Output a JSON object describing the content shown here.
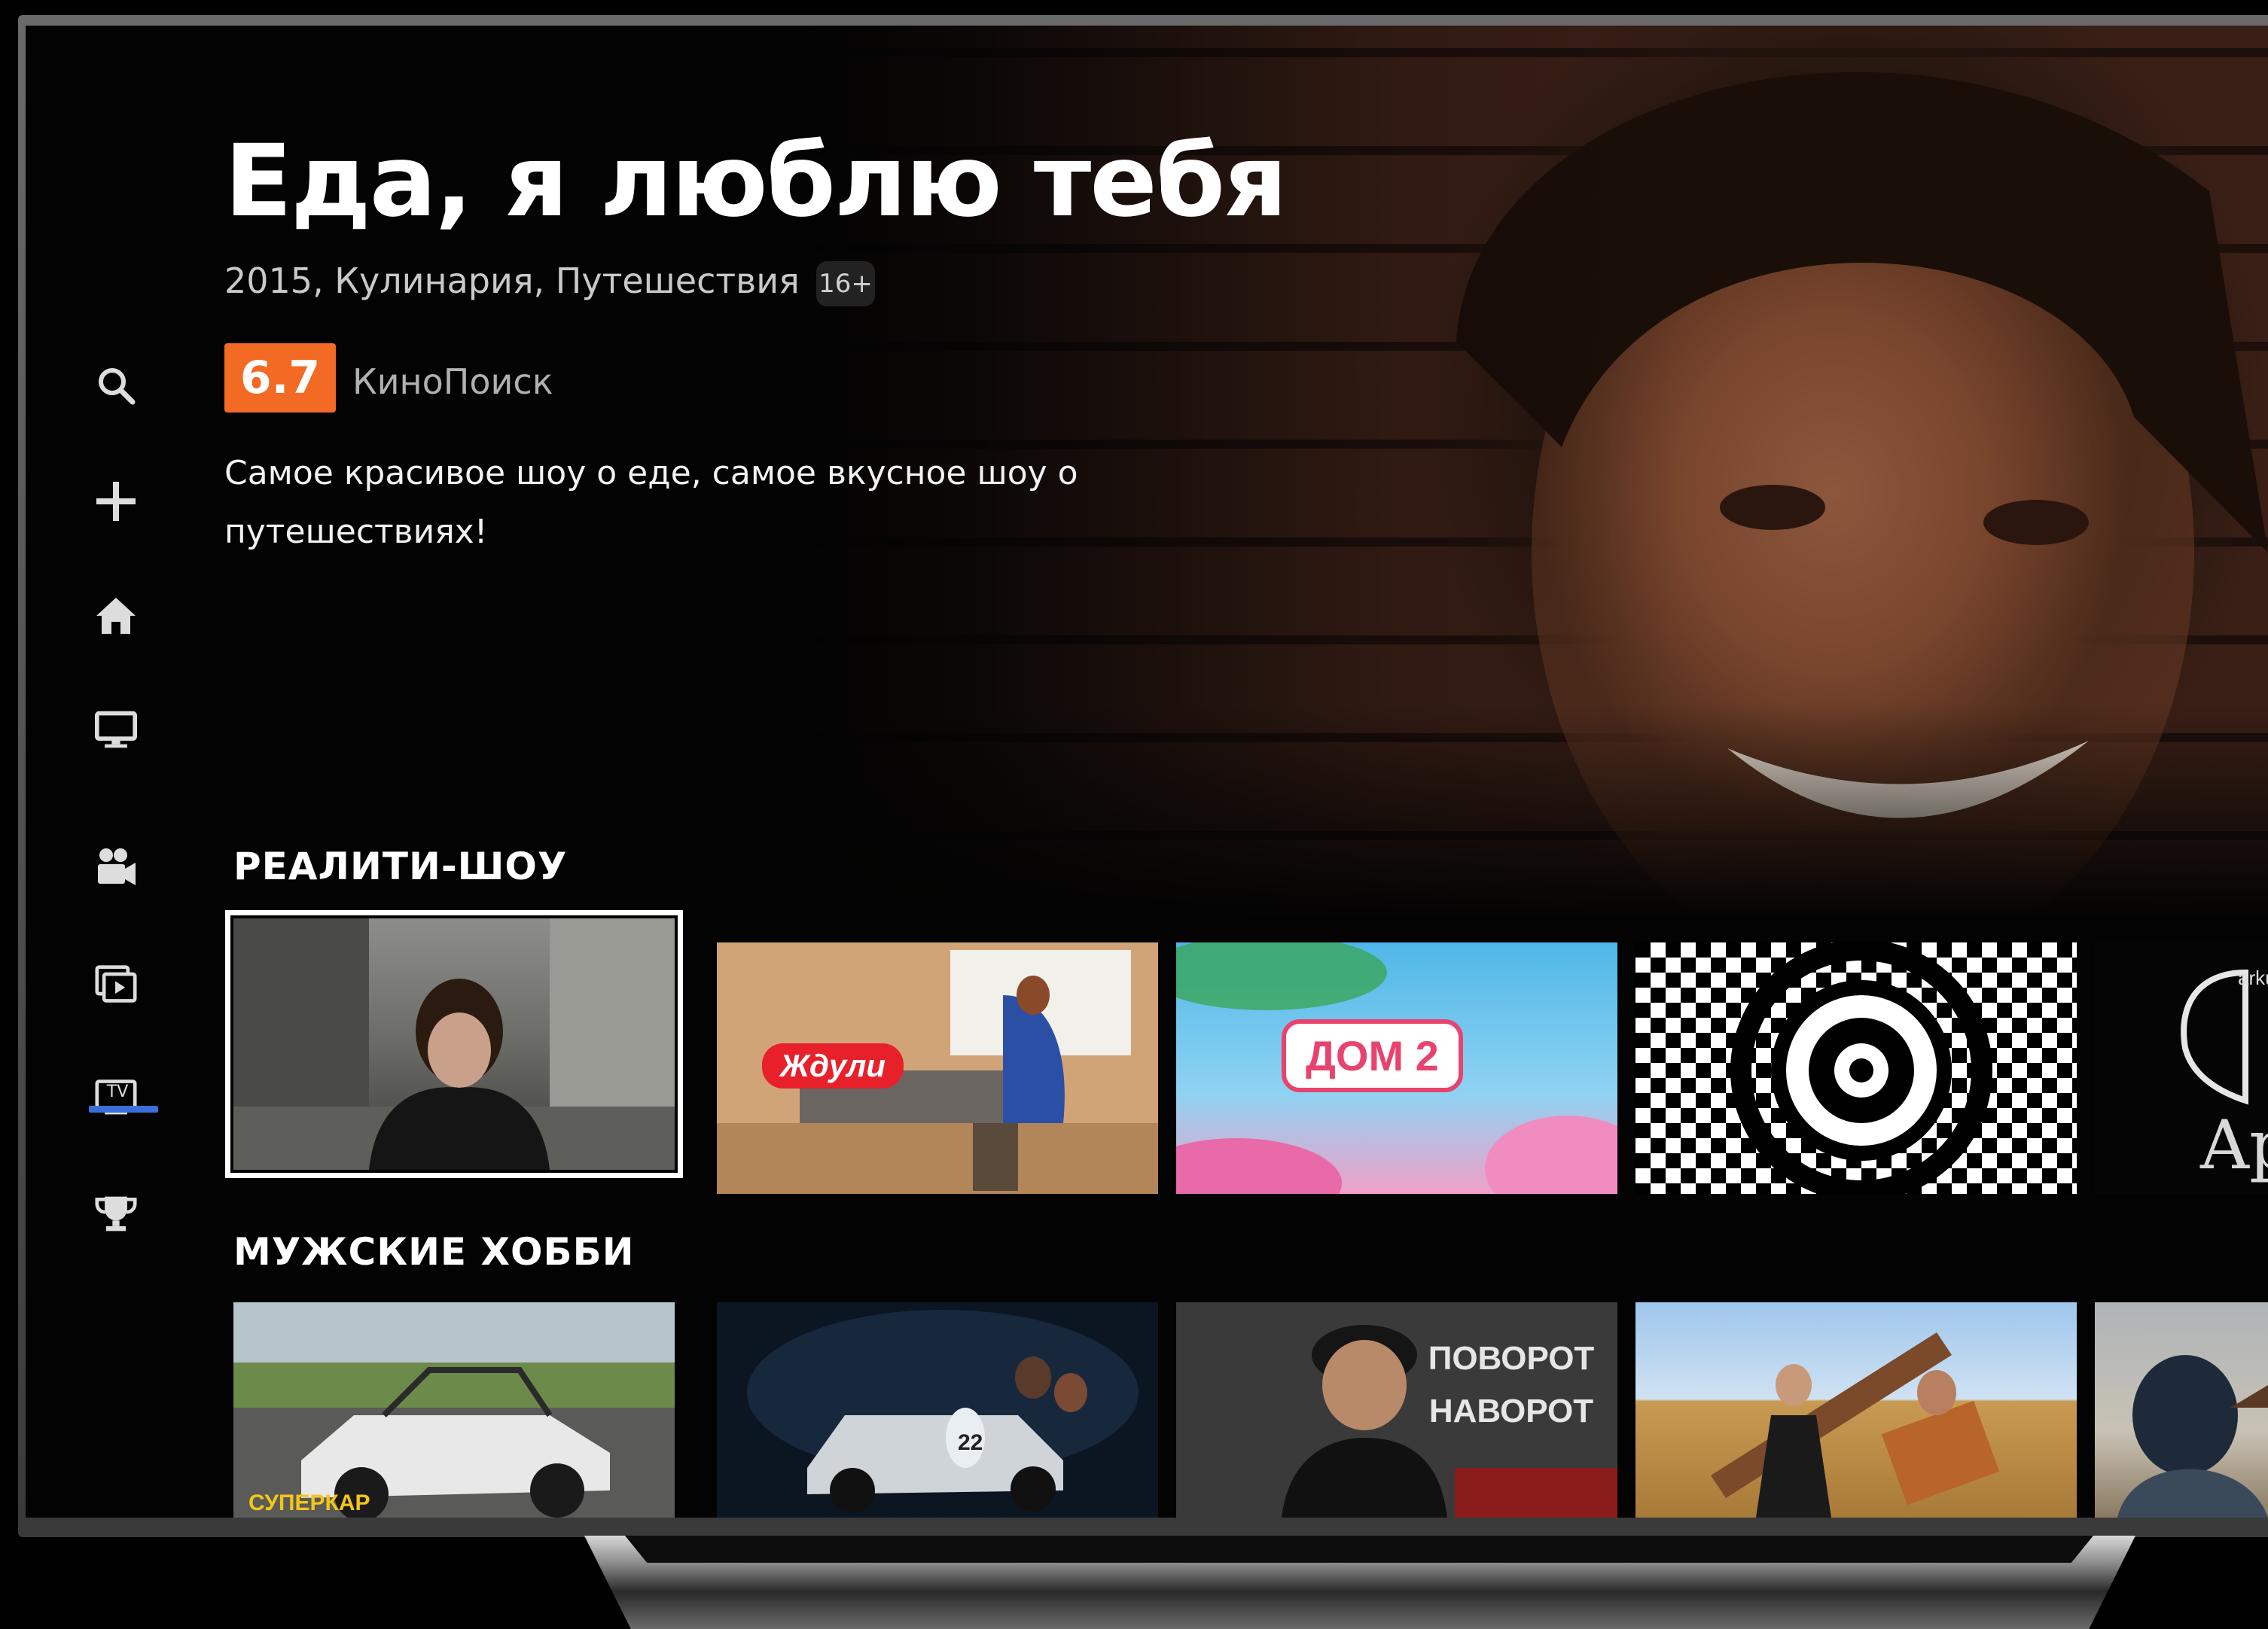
{
  "hero": {
    "title": "Еда, я люблю тебя",
    "meta": "2015, Кулинария, Путешествия",
    "age_rating": "16+",
    "rating": "6.7",
    "rating_source": "КиноПоиск",
    "description": "Самое красивое шоу о еде, самое вкусное шоу о путешествиях!"
  },
  "sidebar": {
    "items": [
      {
        "icon": "search-icon"
      },
      {
        "icon": "plus-icon"
      },
      {
        "icon": "home-icon"
      },
      {
        "icon": "monitor-icon"
      },
      {
        "icon": "movie-camera-icon"
      },
      {
        "icon": "series-icon"
      },
      {
        "icon": "tv-icon",
        "label": "TV",
        "active": true
      },
      {
        "icon": "trophy-icon"
      }
    ]
  },
  "rows": [
    {
      "title": "РЕАЛИТИ-ШОУ",
      "tiles": [
        {
          "label": ""
        },
        {
          "label": "Ждули"
        },
        {
          "label": "ДОМ 2"
        },
        {
          "label": ""
        },
        {
          "label": "arkud"
        }
      ]
    },
    {
      "title": "МУЖСКИЕ ХОББИ",
      "tiles": [
        {
          "label": "СУПЕРКАР"
        },
        {
          "label": ""
        },
        {
          "label": "ПОВОРОТ НАВОРОТ"
        },
        {
          "label": ""
        },
        {
          "label": ""
        }
      ]
    }
  ],
  "colors": {
    "accent_rating": "#f26a23",
    "nav_active": "#3b6fd8",
    "background": "#030303"
  }
}
